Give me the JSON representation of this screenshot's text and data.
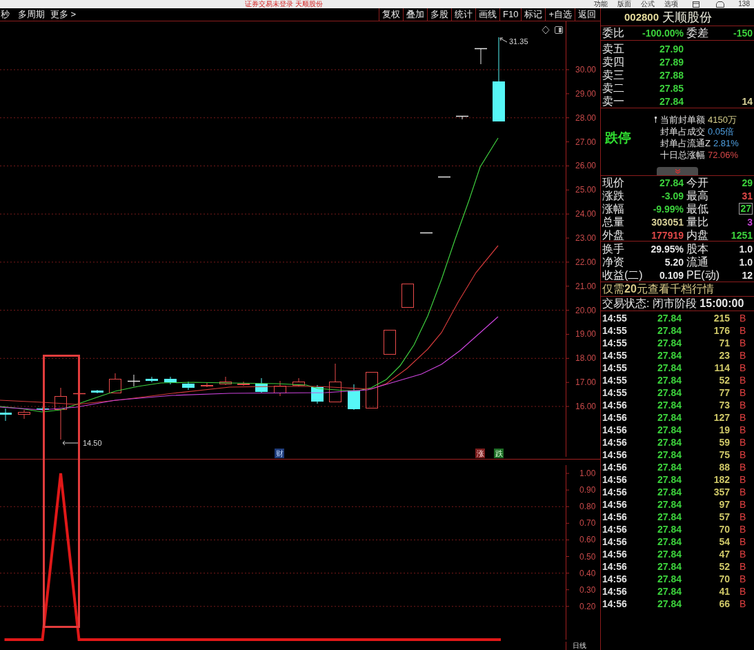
{
  "title_bar": {
    "title": "证券交易未登录  天顺股份",
    "menu": [
      "功能",
      "版面",
      "公式",
      "选项"
    ],
    "count": "138"
  },
  "toolbar": {
    "left_items": [
      "秒",
      "多周期",
      "更多 >"
    ],
    "buttons": [
      "复权",
      "叠加",
      "多股",
      "统计",
      "画线",
      "F10",
      "标记",
      "+自选",
      "返回"
    ]
  },
  "kline_chart": {
    "price_axis": [
      "30.00",
      "29.00",
      "28.00",
      "27.00",
      "26.00",
      "25.00",
      "24.00",
      "23.00",
      "22.00",
      "21.00",
      "20.00",
      "19.00",
      "18.00",
      "17.00",
      "16.00"
    ],
    "high_label": "31.35",
    "low_label": "14.50",
    "markers": [
      {
        "text": "财",
        "kind": "finance"
      },
      {
        "text": "涨",
        "kind": "rise"
      },
      {
        "text": "跌",
        "kind": "fall"
      }
    ]
  },
  "indicator_chart": {
    "chart_data": {
      "type": "line",
      "series": [
        {
          "color": "#e01818",
          "values": [
            0,
            0,
            0,
            1,
            0,
            0,
            0,
            0,
            0,
            0,
            0,
            0,
            0,
            0,
            0,
            0,
            0,
            0,
            0,
            0,
            0,
            0,
            0,
            0,
            0,
            0,
            0,
            0
          ]
        }
      ],
      "ylim": [
        0,
        1.05
      ],
      "grid": true,
      "yticks": [
        {
          "value": 1,
          "label": "1.00"
        },
        {
          "value": 0.9,
          "label": "0.90"
        },
        {
          "value": 0.8,
          "label": "0.80"
        },
        {
          "value": 0.7,
          "label": "0.70"
        },
        {
          "value": 0.6,
          "label": "0.60"
        },
        {
          "value": 0.5,
          "label": "0.50"
        },
        {
          "value": 0.4,
          "label": "0.40"
        },
        {
          "value": 0.3,
          "label": "0.30"
        },
        {
          "value": 0.2,
          "label": "0.20"
        }
      ]
    }
  },
  "bottom_bar": {
    "period": "日线"
  },
  "quote_panel": {
    "code": "002800",
    "name": "天顺股份",
    "order_ratio": [
      {
        "label": "委比",
        "value": "-100.00%"
      },
      {
        "label": "委差",
        "value": "-150"
      }
    ],
    "asks": [
      {
        "label": "卖五",
        "price": "27.90"
      },
      {
        "label": "卖四",
        "price": "27.89"
      },
      {
        "label": "卖三",
        "price": "27.88"
      },
      {
        "label": "卖二",
        "price": "27.85"
      },
      {
        "label": "卖一",
        "price": "27.84",
        "volume": "14"
      }
    ],
    "limit": {
      "status": "跌停",
      "items": [
        {
          "label": "当前封单额",
          "value": "4150万",
          "color": "#d6cf8c",
          "pinned": true
        },
        {
          "label": "封单占成交",
          "value": "0.05倍",
          "color": "#4f9fe0",
          "pinned": false
        },
        {
          "label": "封单占流通Z",
          "value": "2.81%",
          "color": "#4f9fe0",
          "pinned": false
        },
        {
          "label": "十日总涨幅",
          "value": "72.06%",
          "color": "#d84848",
          "pinned": false
        }
      ]
    },
    "stats": [
      {
        "cells": [
          {
            "label": "现价",
            "value": "27.84",
            "color": "#3cd23c",
            "boxed": false
          },
          {
            "label": "今开",
            "value": "29",
            "color": "#3cd23c",
            "boxed": false
          }
        ]
      },
      {
        "cells": [
          {
            "label": "涨跌",
            "value": "-3.09",
            "color": "#3cd23c",
            "boxed": false
          },
          {
            "label": "最高",
            "value": "31",
            "color": "#e04848",
            "boxed": false
          }
        ]
      },
      {
        "cells": [
          {
            "label": "涨幅",
            "value": "-9.99%",
            "color": "#3cd23c",
            "boxed": false
          },
          {
            "label": "最低",
            "value": "27",
            "color": "#3cd23c",
            "boxed": true
          }
        ]
      },
      {
        "cells": [
          {
            "label": "总量",
            "value": "303051",
            "color": "#d8d098",
            "boxed": false
          },
          {
            "label": "量比",
            "value": "3",
            "color": "#c040d0",
            "boxed": false
          }
        ]
      },
      {
        "cells": [
          {
            "label": "外盘",
            "value": "177919",
            "color": "#e04848",
            "boxed": false
          },
          {
            "label": "内盘",
            "value": "1251",
            "color": "#3cd23c",
            "boxed": false
          }
        ]
      }
    ],
    "fundamentals": [
      {
        "cells": [
          {
            "label": "换手",
            "value": "29.95%"
          },
          {
            "label": "股本",
            "value": "1.0"
          }
        ]
      },
      {
        "cells": [
          {
            "label": "净资",
            "value": "5.20"
          },
          {
            "label": "流通",
            "value": "1.0"
          }
        ]
      },
      {
        "cells": [
          {
            "label": "收益(二)",
            "value": "0.109"
          },
          {
            "label": "PE(动)",
            "value": "12"
          }
        ]
      }
    ],
    "promo": "仅需**20**元查看千档行情",
    "trade_status": "交易状态: 闭市阶段 **15:00:00**",
    "trades": [
      {
        "time": "14:55",
        "price": "27.84",
        "volume": "215",
        "side": "B",
        "color": "#e04040"
      },
      {
        "time": "14:55",
        "price": "27.84",
        "volume": "176",
        "side": "B",
        "color": "#e04040"
      },
      {
        "time": "14:55",
        "price": "27.84",
        "volume": "71",
        "side": "B",
        "color": "#e04040"
      },
      {
        "time": "14:55",
        "price": "27.84",
        "volume": "23",
        "side": "B",
        "color": "#e04040"
      },
      {
        "time": "14:55",
        "price": "27.84",
        "volume": "114",
        "side": "B",
        "color": "#e04040"
      },
      {
        "time": "14:55",
        "price": "27.84",
        "volume": "52",
        "side": "B",
        "color": "#e04040"
      },
      {
        "time": "14:55",
        "price": "27.84",
        "volume": "77",
        "side": "B",
        "color": "#e04040"
      },
      {
        "time": "14:56",
        "price": "27.84",
        "volume": "73",
        "side": "B",
        "color": "#e04040"
      },
      {
        "time": "14:56",
        "price": "27.84",
        "volume": "127",
        "side": "B",
        "color": "#e04040"
      },
      {
        "time": "14:56",
        "price": "27.84",
        "volume": "19",
        "side": "B",
        "color": "#e04040"
      },
      {
        "time": "14:56",
        "price": "27.84",
        "volume": "59",
        "side": "B",
        "color": "#e04040"
      },
      {
        "time": "14:56",
        "price": "27.84",
        "volume": "75",
        "side": "B",
        "color": "#e04040"
      },
      {
        "time": "14:56",
        "price": "27.84",
        "volume": "88",
        "side": "B",
        "color": "#e04040"
      },
      {
        "time": "14:56",
        "price": "27.84",
        "volume": "182",
        "side": "B",
        "color": "#e04040"
      },
      {
        "time": "14:56",
        "price": "27.84",
        "volume": "357",
        "side": "B",
        "color": "#e04040"
      },
      {
        "time": "14:56",
        "price": "27.84",
        "volume": "97",
        "side": "B",
        "color": "#e04040"
      },
      {
        "time": "14:56",
        "price": "27.84",
        "volume": "57",
        "side": "B",
        "color": "#e04040"
      },
      {
        "time": "14:56",
        "price": "27.84",
        "volume": "70",
        "side": "B",
        "color": "#e04040"
      },
      {
        "time": "14:56",
        "price": "27.84",
        "volume": "54",
        "side": "B",
        "color": "#e04040"
      },
      {
        "time": "14:56",
        "price": "27.84",
        "volume": "47",
        "side": "B",
        "color": "#e04040"
      },
      {
        "time": "14:56",
        "price": "27.84",
        "volume": "52",
        "side": "B",
        "color": "#e04040"
      },
      {
        "time": "14:56",
        "price": "27.84",
        "volume": "70",
        "side": "B",
        "color": "#e04040"
      },
      {
        "time": "14:56",
        "price": "27.84",
        "volume": "41",
        "side": "B",
        "color": "#e04040"
      },
      {
        "time": "14:56",
        "price": "27.84",
        "volume": "66",
        "side": "B",
        "color": "#e04040"
      }
    ]
  }
}
